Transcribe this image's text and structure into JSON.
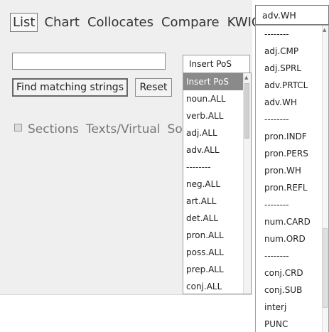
{
  "tabs": [
    "List",
    "Chart",
    "Collocates",
    "Compare",
    "KWIC"
  ],
  "search": {
    "value": "",
    "placeholder": ""
  },
  "buttons": {
    "find": "Find matching strings",
    "reset": "Reset"
  },
  "options": {
    "sections": "Sections",
    "texts": "Texts/Virtual",
    "sort": "So"
  },
  "pos_select": {
    "value": "Insert PoS",
    "items": [
      "Insert PoS",
      "noun.ALL",
      "verb.ALL",
      "adj.ALL",
      "adv.ALL",
      "--------",
      "neg.ALL",
      "art.ALL",
      "det.ALL",
      "pron.ALL",
      "poss.ALL",
      "prep.ALL",
      "conj.ALL"
    ],
    "selected_index": 0
  },
  "right_select": {
    "value": "adv.WH",
    "items": [
      "--------",
      "adj.CMP",
      "adj.SPRL",
      "adv.PRTCL",
      "adv.WH",
      "--------",
      "pron.INDF",
      "pron.PERS",
      "pron.WH",
      "pron.REFL",
      "--------",
      "num.CARD",
      "num.ORD",
      "--------",
      "conj.CRD",
      "conj.SUB",
      "interj",
      "PUNC"
    ]
  }
}
